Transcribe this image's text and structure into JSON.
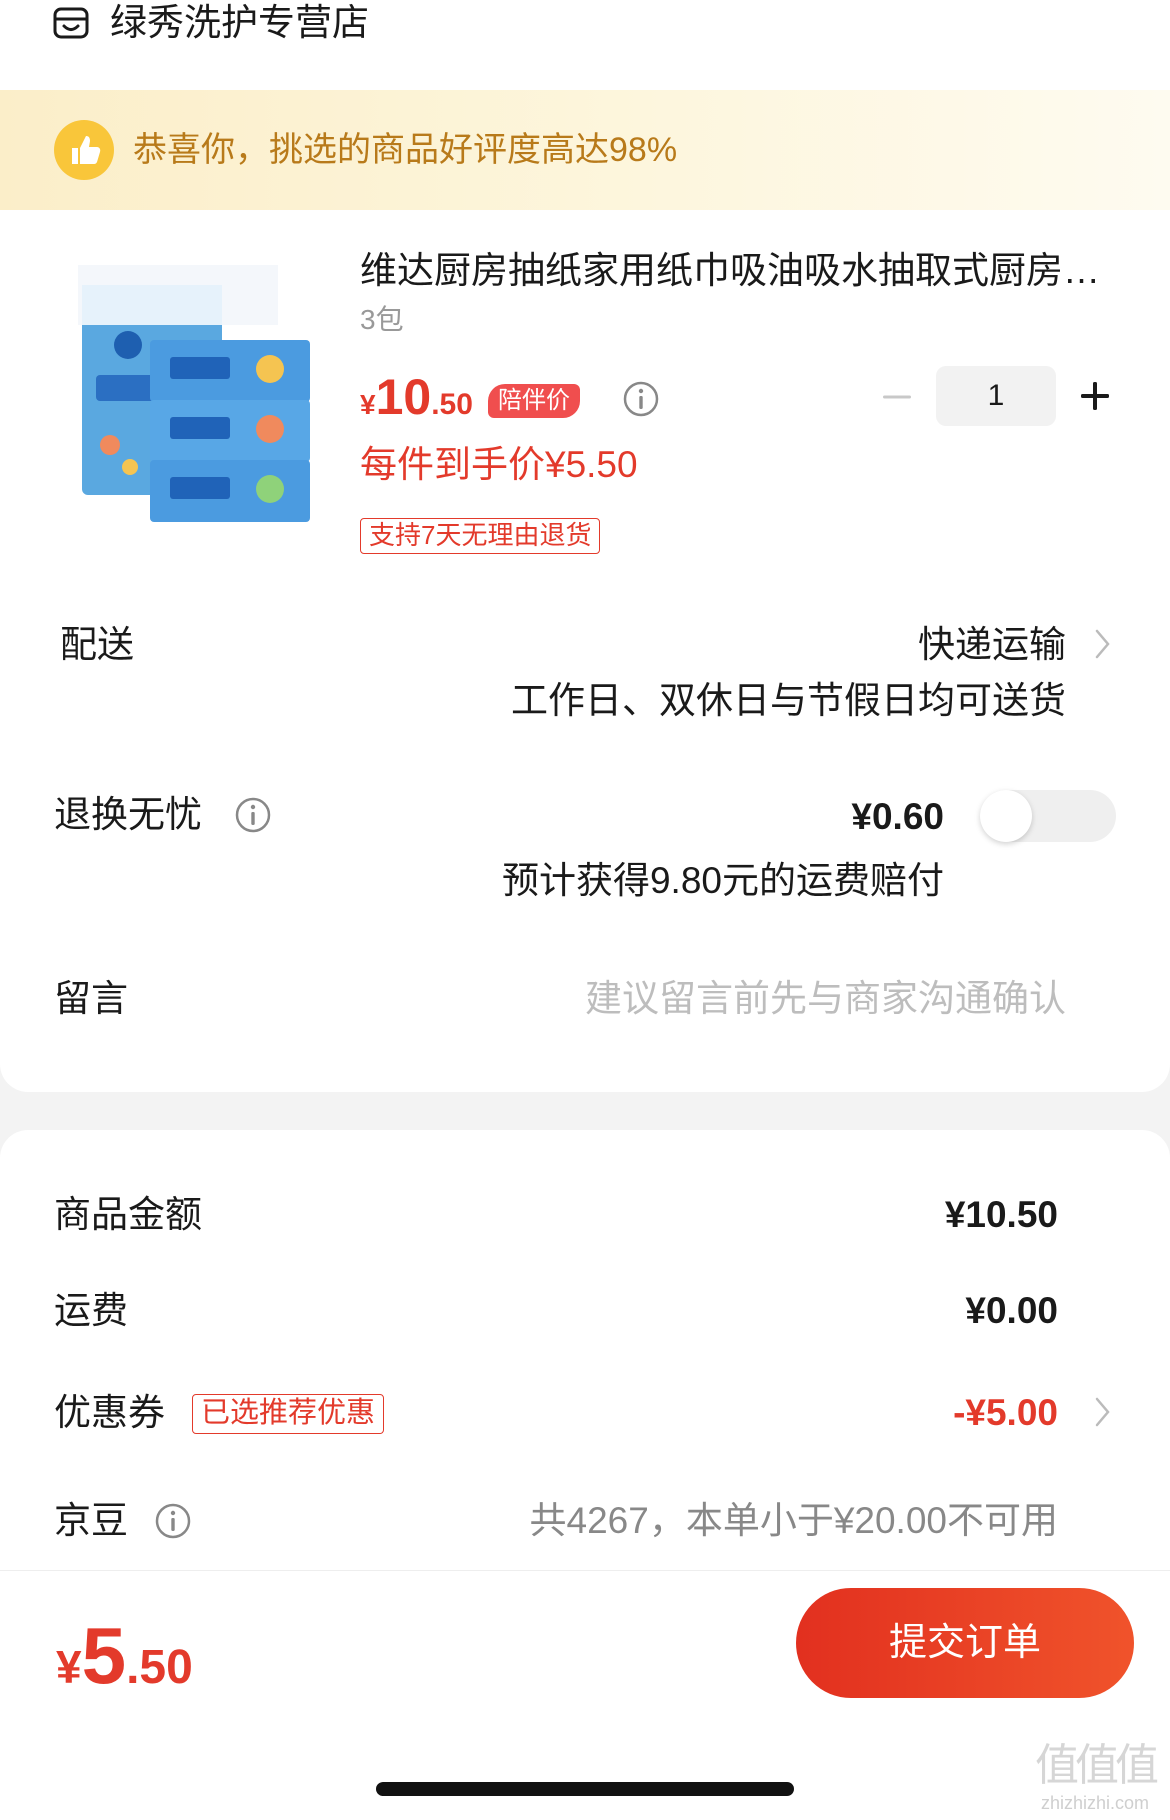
{
  "store": {
    "name": "绿秀洗护专营店",
    "icon": "store-icon"
  },
  "banner": {
    "text": "恭喜你，挑选的商品好评度高达98%",
    "icon": "thumbs-up-icon"
  },
  "product": {
    "title": "维达厨房抽纸家用纸巾吸油吸水抽取式厨房用纸",
    "variant": "3包",
    "price_currency": "¥",
    "price_int": "10",
    "price_dec": ".50",
    "price_tag": "陪伴价",
    "net_price": "每件到手价¥5.50",
    "return_badge": "支持7天无理由退货",
    "quantity": "1"
  },
  "delivery": {
    "label": "配送",
    "method": "快递运输",
    "note": "工作日、双休日与节假日均可送货"
  },
  "return_insurance": {
    "label": "退换无忧",
    "price": "¥0.60",
    "note": "预计获得9.80元的运费赔付",
    "enabled": false
  },
  "message": {
    "label": "留言",
    "placeholder": "建议留言前先与商家沟通确认"
  },
  "summary": {
    "goods_label": "商品金额",
    "goods_value": "¥10.50",
    "shipping_label": "运费",
    "shipping_value": "¥0.00",
    "coupon_label": "优惠券",
    "coupon_badge": "已选推荐优惠",
    "coupon_value": "-¥5.00",
    "jingdou_label": "京豆",
    "jingdou_value": "共4267，本单小于¥20.00不可用"
  },
  "footer": {
    "total_currency": "¥",
    "total_int": "5",
    "total_dec": ".50",
    "submit_label": "提交订单"
  },
  "watermark": {
    "line1": "值值值",
    "line2": "zhizhizhi.com"
  },
  "colors": {
    "accent": "#e33a2b",
    "banner_text": "#b87a1a",
    "badge_bg": "#f04e4e"
  }
}
